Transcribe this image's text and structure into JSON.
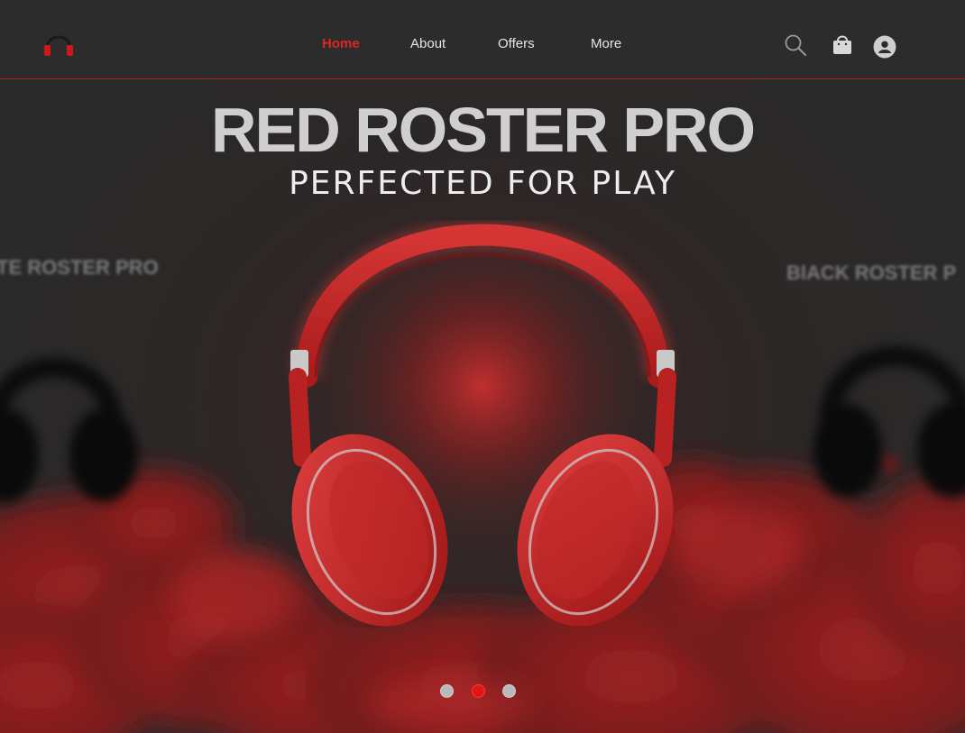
{
  "header": {
    "logo_icon": "headphones-icon",
    "nav": [
      {
        "label": "Home",
        "active": true
      },
      {
        "label": "About",
        "active": false
      },
      {
        "label": "Offers",
        "active": false
      },
      {
        "label": "More",
        "active": false
      }
    ],
    "icons": [
      "search-icon",
      "shopping-bag-icon",
      "user-account-icon"
    ]
  },
  "hero": {
    "title": "RED ROSTER PRO",
    "subtitle": "PERFECTED FOR PLAY",
    "prev_product_label": "TE ROSTER PRO",
    "next_product_label": "BlACK ROSTER P"
  },
  "carousel": {
    "slide_count": 3,
    "active_index": 1
  },
  "colors": {
    "accent": "#e02424",
    "background": "#2c2c2c",
    "title_gray": "#cfcfcf"
  }
}
